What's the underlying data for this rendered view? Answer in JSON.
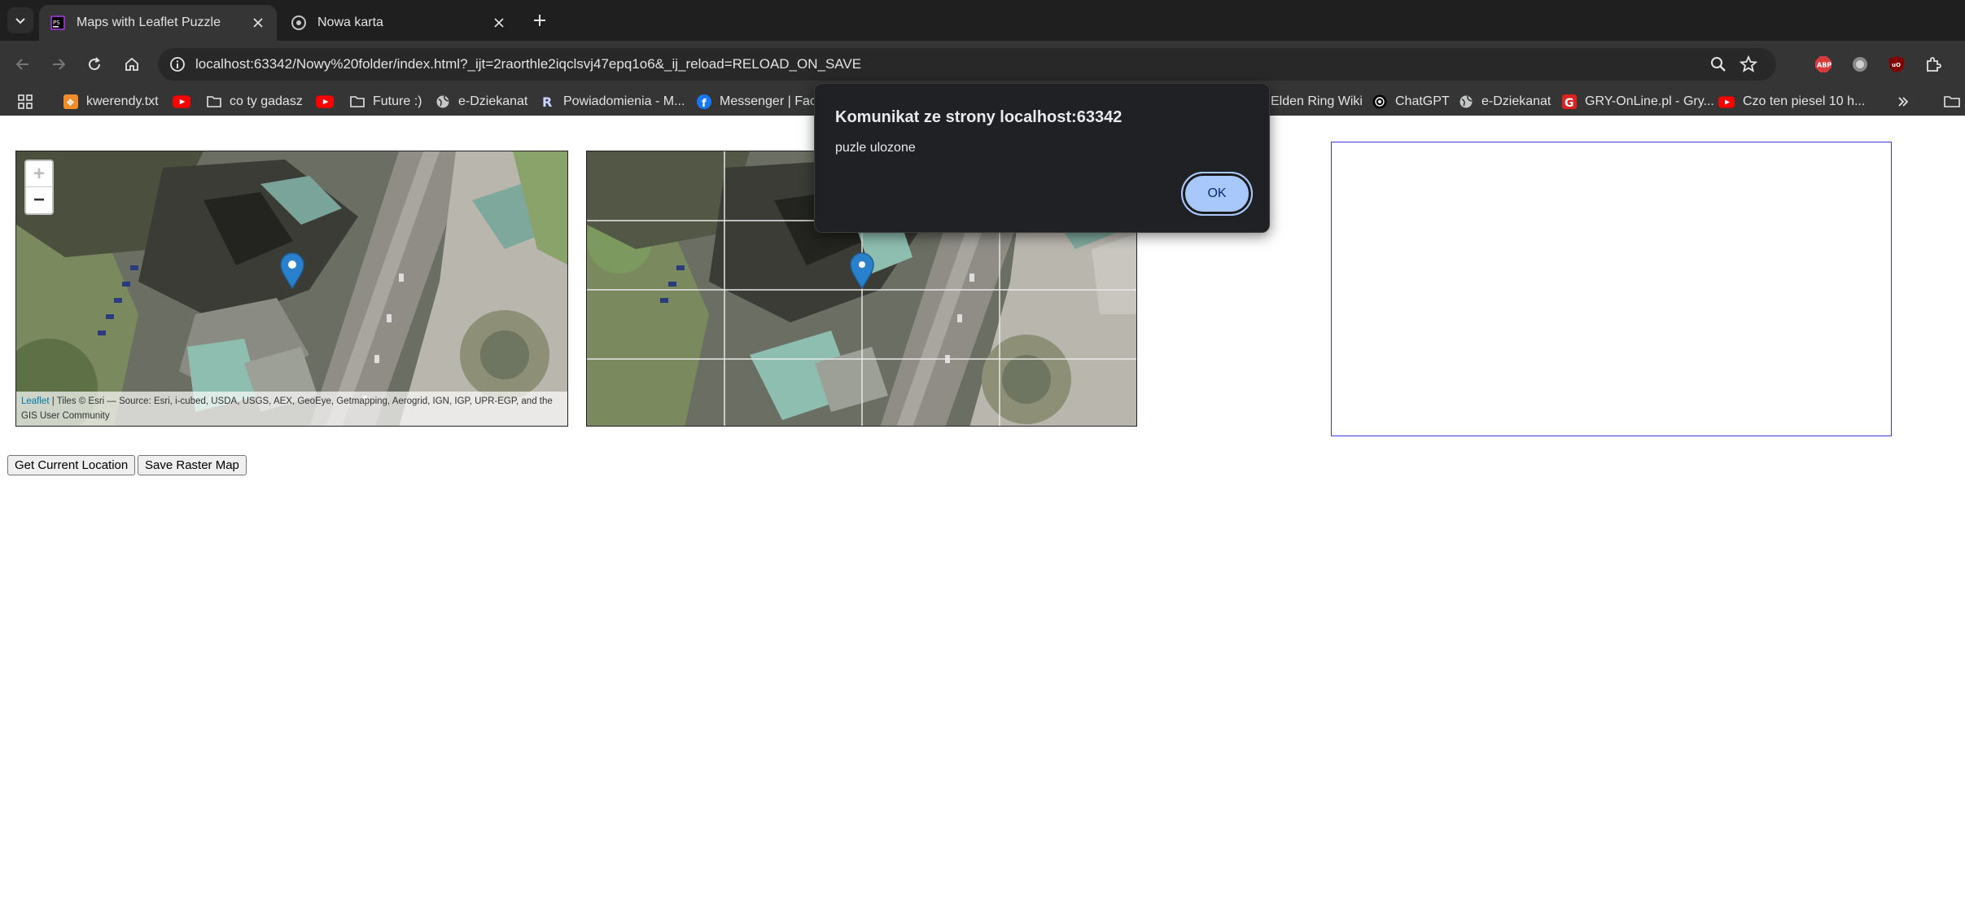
{
  "browser": {
    "tabs": [
      {
        "label": "Maps with Leaflet Puzzle",
        "active": true,
        "favicon": "phpstorm-icon"
      },
      {
        "label": "Nowa karta",
        "active": false,
        "favicon": "chrome-icon"
      }
    ],
    "url": "localhost:63342/Nowy%20folder/index.html?_ijt=2raorthle2iqclsvj47epq1o6&_ij_reload=RELOAD_ON_SAVE",
    "bookmarks": [
      {
        "label": "kwerendy.txt",
        "icon": "bookmark-icon"
      },
      {
        "label": "",
        "icon": "youtube-icon"
      },
      {
        "label": "co ty gadasz",
        "icon": "folder-icon"
      },
      {
        "label": "",
        "icon": "youtube-icon"
      },
      {
        "label": "Future :)",
        "icon": "folder-icon"
      },
      {
        "label": "e-Dziekanat",
        "icon": "globe-icon"
      },
      {
        "label": "Powiadomienia - M...",
        "icon": "r-icon"
      },
      {
        "label": "Messenger | Facel",
        "icon": "facebook-icon"
      },
      {
        "label": "Elden Ring Wiki",
        "icon": "bookmark-icon"
      },
      {
        "label": "ChatGPT",
        "icon": "chatgpt-icon"
      },
      {
        "label": "e-Dziekanat",
        "icon": "globe-icon"
      },
      {
        "label": "GRY-OnLine.pl - Gry...",
        "icon": "gry-online-icon"
      },
      {
        "label": "Czo ten piesel 10 h...",
        "icon": "youtube-icon"
      }
    ],
    "extensions": [
      "adblock-plus-icon",
      "extension-circle-icon",
      "ublock-origin-icon",
      "extensions-puzzle-icon"
    ]
  },
  "page": {
    "map_attribution_link": "Leaflet",
    "map_attribution_text": "| Tiles © Esri — Source: Esri, i-cubed, USDA, USGS, AEX, GeoEye, Getmapping, Aerogrid, IGN, IGP, UPR-EGP, and the GIS User Community",
    "zoom_in": "+",
    "zoom_out": "−",
    "buttons": {
      "get_location": "Get Current Location",
      "save_raster": "Save Raster Map"
    }
  },
  "dialog": {
    "title": "Komunikat ze strony localhost:63342",
    "message": "puzle ulozone",
    "ok_label": "OK"
  },
  "colors": {
    "chrome_dark": "#1f1f1f",
    "toolbar": "#353535",
    "dialog_bg": "#202124",
    "ok_button": "#a8c7fa",
    "canvas_border": "#3b3be0",
    "marker_blue": "#2a81cb"
  }
}
